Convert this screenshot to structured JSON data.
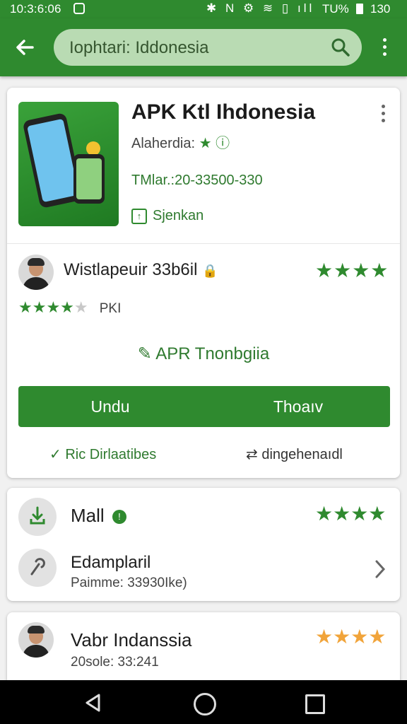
{
  "status_bar": {
    "time": "10:3:6:06",
    "icons": "✱ N ⚙ ≋ ▯ ıll",
    "battery_pct": "TU%",
    "battery_num": "130"
  },
  "app_bar": {
    "search_query": "Iophtari: Iddonesia"
  },
  "app": {
    "title": "APK Ktl Ihdonesia",
    "developer": "Alaherdia:",
    "updated": "TMlar.:20-33500-330",
    "install_link": "Sjenkan"
  },
  "review": {
    "name": "Wistlapeuir 33b6il",
    "stars": "★★★★",
    "rating_filled": "★★★★",
    "rating_empty": "★",
    "rating_tag": "PKI",
    "apr_label": "APR Tnonbgiia"
  },
  "actions": {
    "primary": "Undu",
    "secondary": "Thoaıv"
  },
  "footer": {
    "left": "Ric Dirlaatibes",
    "right": "dingehenaıdl"
  },
  "list": [
    {
      "title": "Mall",
      "stars": "★★★★",
      "subtitle": "Edamplaril",
      "meta": "Paimme: 33930Ike)"
    },
    {
      "title": "Vabr Indanssia",
      "stars": "★★★★",
      "meta": "20sole: 33:241"
    }
  ],
  "colors": {
    "primary": "#2f8a2f",
    "accent_star": "#f1a43a"
  }
}
